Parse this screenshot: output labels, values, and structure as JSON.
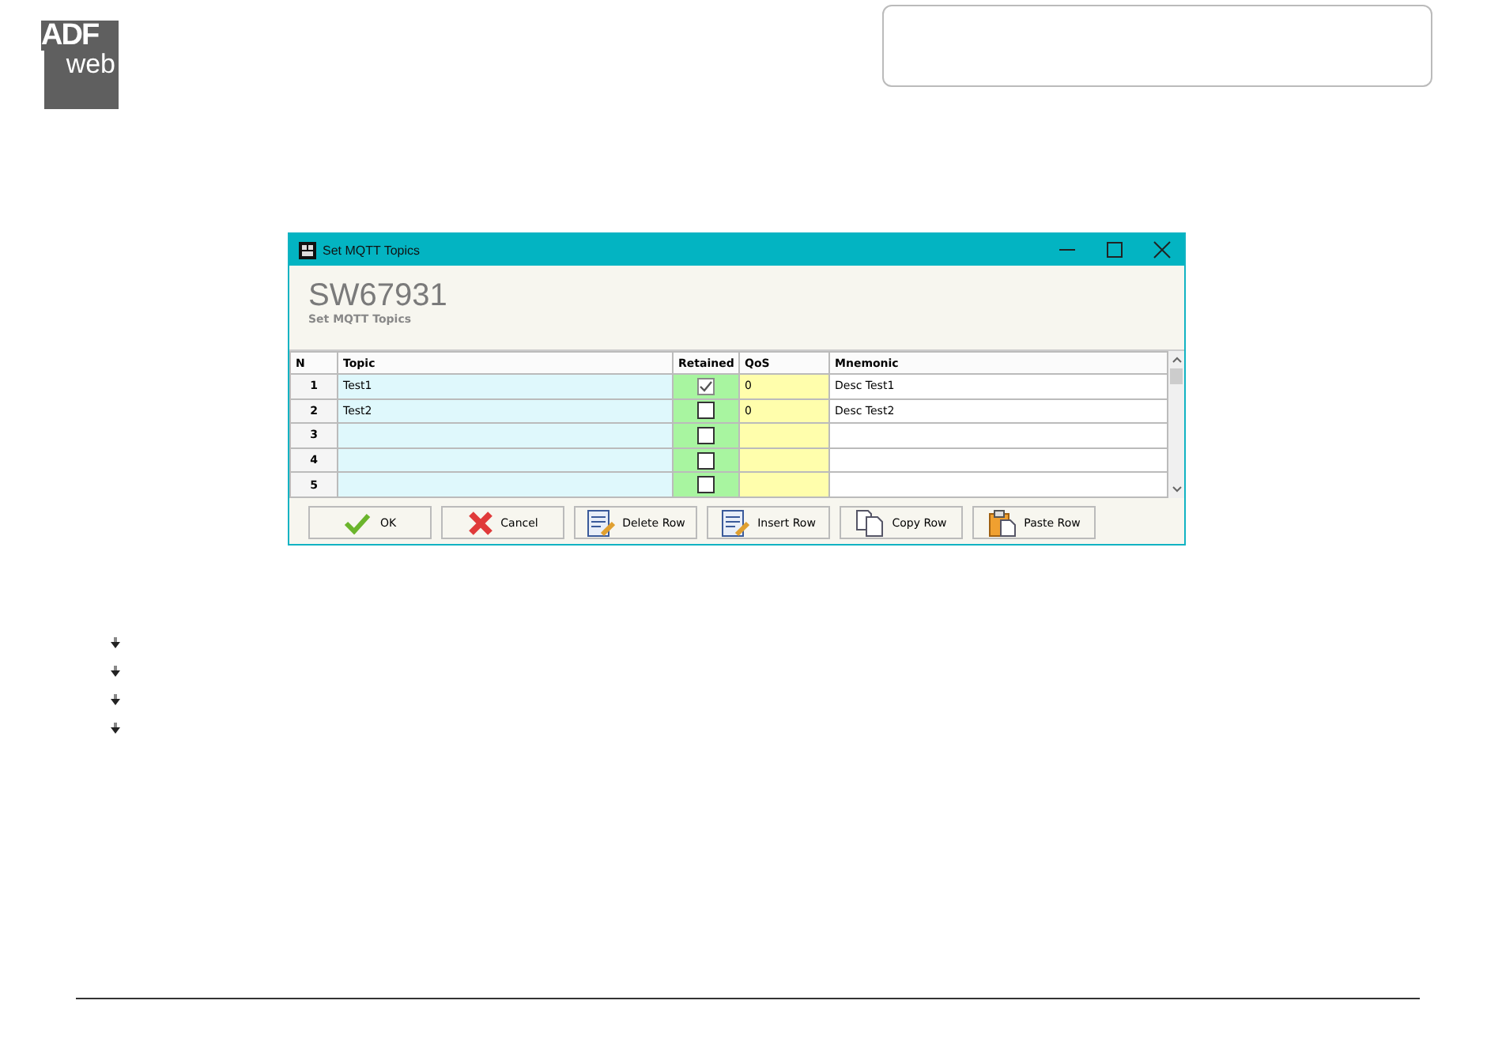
{
  "logo": {
    "top": "ADF",
    "bottom": "web"
  },
  "window": {
    "title": "Set MQTT Topics",
    "heading": "SW67931",
    "subheading": "Set MQTT Topics"
  },
  "table": {
    "columns": [
      "N",
      "Topic",
      "Retained",
      "QoS",
      "Mnemonic"
    ],
    "rows": [
      {
        "n": "1",
        "topic": "Test1",
        "retained": true,
        "qos": "0",
        "mnemonic": "Desc Test1"
      },
      {
        "n": "2",
        "topic": "Test2",
        "retained": false,
        "qos": "0",
        "mnemonic": "Desc Test2"
      },
      {
        "n": "3",
        "topic": "",
        "retained": false,
        "qos": "",
        "mnemonic": ""
      },
      {
        "n": "4",
        "topic": "",
        "retained": false,
        "qos": "",
        "mnemonic": ""
      },
      {
        "n": "5",
        "topic": "",
        "retained": false,
        "qos": "",
        "mnemonic": ""
      }
    ]
  },
  "buttons": [
    {
      "label": "OK",
      "kind": "ok"
    },
    {
      "label": "Cancel",
      "kind": "cancel"
    },
    {
      "label": "Delete Row",
      "kind": "delete"
    },
    {
      "label": "Insert Row",
      "kind": "insert"
    },
    {
      "label": "Copy Row",
      "kind": "copy"
    },
    {
      "label": "Paste Row",
      "kind": "paste"
    }
  ],
  "bullets": [
    {
      "kind": "arrow"
    },
    {
      "kind": "arrow"
    },
    {
      "kind": "arrow"
    },
    {
      "kind": "arrow"
    }
  ]
}
